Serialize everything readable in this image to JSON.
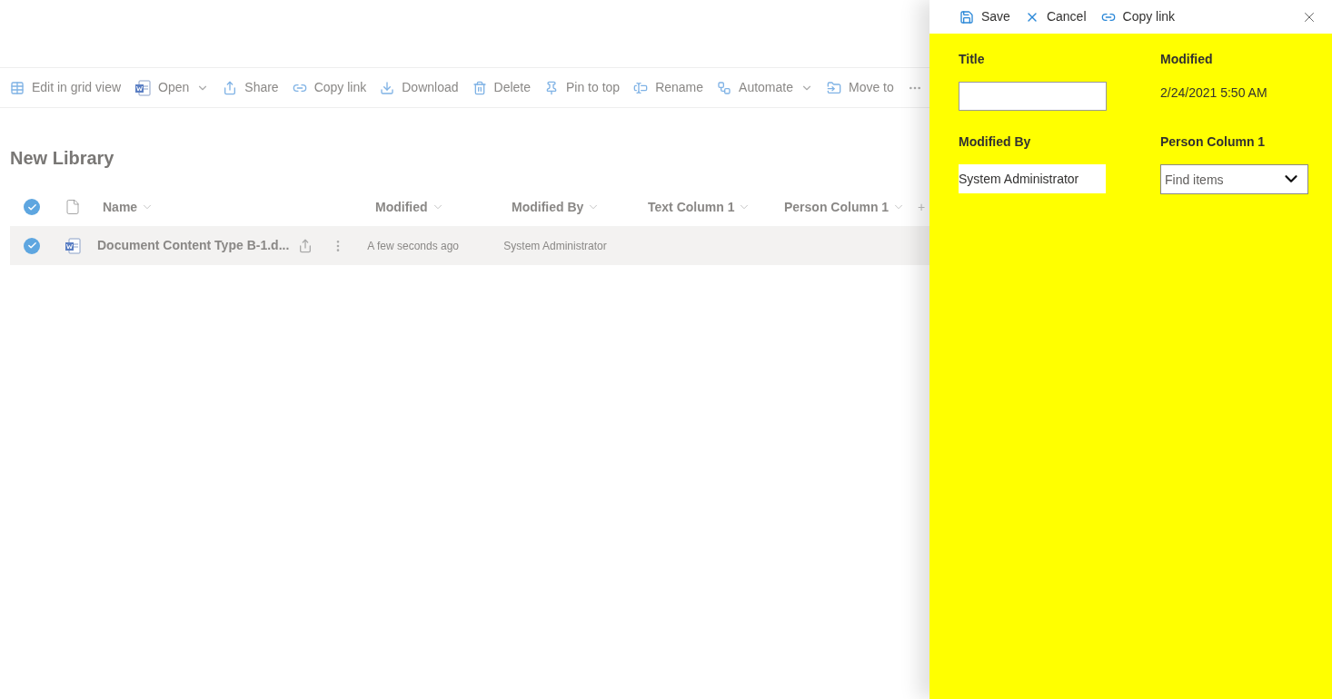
{
  "toolbar": [
    {
      "label": "Edit in grid view",
      "has_menu": false
    },
    {
      "label": "Open",
      "has_menu": true
    },
    {
      "label": "Share",
      "has_menu": false
    },
    {
      "label": "Copy link",
      "has_menu": false
    },
    {
      "label": "Download",
      "has_menu": false
    },
    {
      "label": "Delete",
      "has_menu": false
    },
    {
      "label": "Pin to top",
      "has_menu": false
    },
    {
      "label": "Rename",
      "has_menu": false
    },
    {
      "label": "Automate",
      "has_menu": true
    },
    {
      "label": "Move to",
      "has_menu": false
    }
  ],
  "library_title": "New Library",
  "columns": [
    "Name",
    "Modified",
    "Modified By",
    "Text Column 1",
    "Person Column 1"
  ],
  "add_column": "+",
  "rows": [
    {
      "name": "Document Content Type B-1.d...",
      "modified": "A few seconds ago",
      "modified_by": "System Administrator",
      "selected": true
    }
  ],
  "panel": {
    "commands": [
      "Save",
      "Cancel",
      "Copy link"
    ],
    "fields": [
      {
        "label": "Title",
        "kind": "text"
      },
      {
        "label": "Modified",
        "kind": "readonly",
        "value": "2/24/2021 5:50 AM"
      },
      {
        "label": "Modified By",
        "kind": "person",
        "value": "System Administrator"
      },
      {
        "label": "Person Column 1",
        "kind": "picker",
        "placeholder": "Find items"
      }
    ]
  }
}
